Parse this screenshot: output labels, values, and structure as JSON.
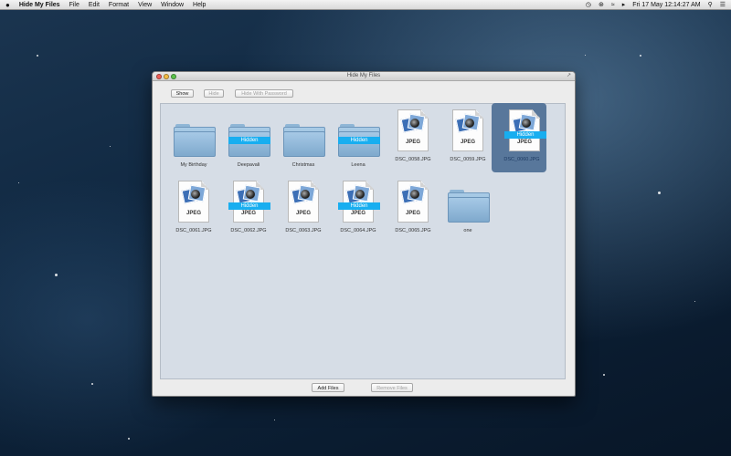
{
  "menubar": {
    "apple": "",
    "app_name": "Hide My Files",
    "menus": [
      "File",
      "Edit",
      "Format",
      "View",
      "Window",
      "Help"
    ],
    "clock": "Fri 17 May  12:14:27 AM",
    "icons": [
      "time-machine-icon",
      "bluetooth-icon",
      "wifi-icon",
      "volume-icon",
      "search-icon",
      "list-icon"
    ]
  },
  "window": {
    "title": "Hide My Files",
    "toolbar": {
      "show_label": "Show",
      "hide_label": "Hide",
      "hide_with_password_label": "Hide With Password"
    },
    "items": [
      {
        "name": "My Birthday",
        "type": "folder",
        "hidden": false
      },
      {
        "name": "Deepavali",
        "type": "folder",
        "hidden": true
      },
      {
        "name": "Christmas",
        "type": "folder",
        "hidden": false
      },
      {
        "name": "Leena",
        "type": "folder",
        "hidden": true
      },
      {
        "name": "DSC_0058.JPG",
        "type": "jpeg",
        "hidden": false
      },
      {
        "name": "DSC_0059.JPG",
        "type": "jpeg",
        "hidden": false
      },
      {
        "name": "DSC_0060.JPG",
        "type": "jpeg",
        "hidden": true,
        "selected": true
      },
      {
        "name": "DSC_0061.JPG",
        "type": "jpeg",
        "hidden": false
      },
      {
        "name": "DSC_0062.JPG",
        "type": "jpeg",
        "hidden": true
      },
      {
        "name": "DSC_0063.JPG",
        "type": "jpeg",
        "hidden": false
      },
      {
        "name": "DSC_0064.JPG",
        "type": "jpeg",
        "hidden": true
      },
      {
        "name": "DSC_0065.JPG",
        "type": "jpeg",
        "hidden": false
      },
      {
        "name": "one",
        "type": "folder",
        "hidden": false
      }
    ],
    "hidden_badge": "Hidden",
    "jpeg_badge": "JPEG",
    "bottom": {
      "add_files_label": "Add Files",
      "remove_files_label": "Remove Files"
    }
  },
  "colors": {
    "hidden_band": "#18aef0",
    "selection": "#58779b",
    "content_bg": "#d6dde6"
  }
}
